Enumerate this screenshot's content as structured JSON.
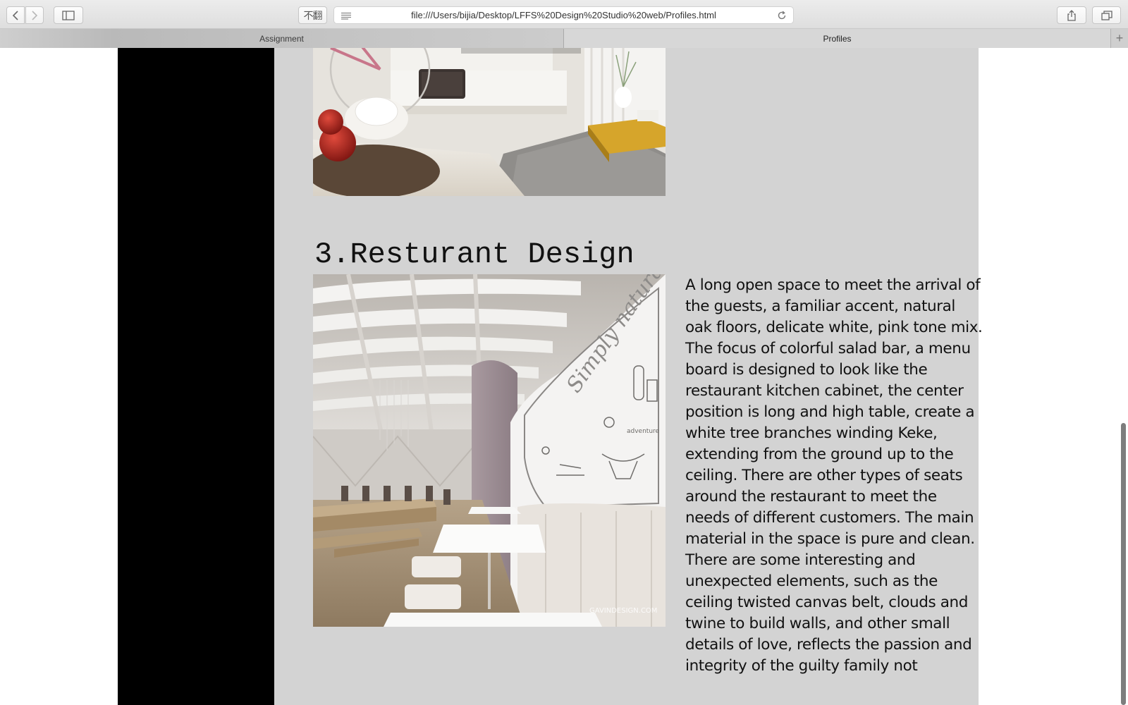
{
  "browser": {
    "url": "file:///Users/bijia/Desktop/LFFS%20Design%20Studio%20web/Profiles.html",
    "translate_label": "不翻",
    "tabs": [
      {
        "label": "Assignment",
        "active": false
      },
      {
        "label": "Profiles",
        "active": true
      }
    ],
    "new_tab_symbol": "+"
  },
  "page": {
    "section": {
      "title": "3.Resturant Design",
      "description": "A long open space to meet the arrival of the guests, a familiar accent, natural oak floors, delicate white, pink tone mix. The focus of colorful salad bar, a menu board is designed to look like the restaurant kitchen cabinet, the center position is long and high table, create a white tree branches winding Keke, extending from the ground up to the ceiling. There are other types of seats around the restaurant to meet the needs of different customers. The main material in the space is pure and clean. There are some interesting and unexpected elements, such as the ceiling twisted canvas belt, clouds and twine to build walls, and other small details of love, reflects the passion and integrity of the guilty family not",
      "mural_text": "Simply natural",
      "mural_sub": "adventure",
      "watermark": "GAVINDESIGN.COM"
    }
  },
  "colors": {
    "content_bg": "#d3d3d3",
    "sidebar_bg": "#000000",
    "chrome_bg": "#e4e4e4"
  }
}
